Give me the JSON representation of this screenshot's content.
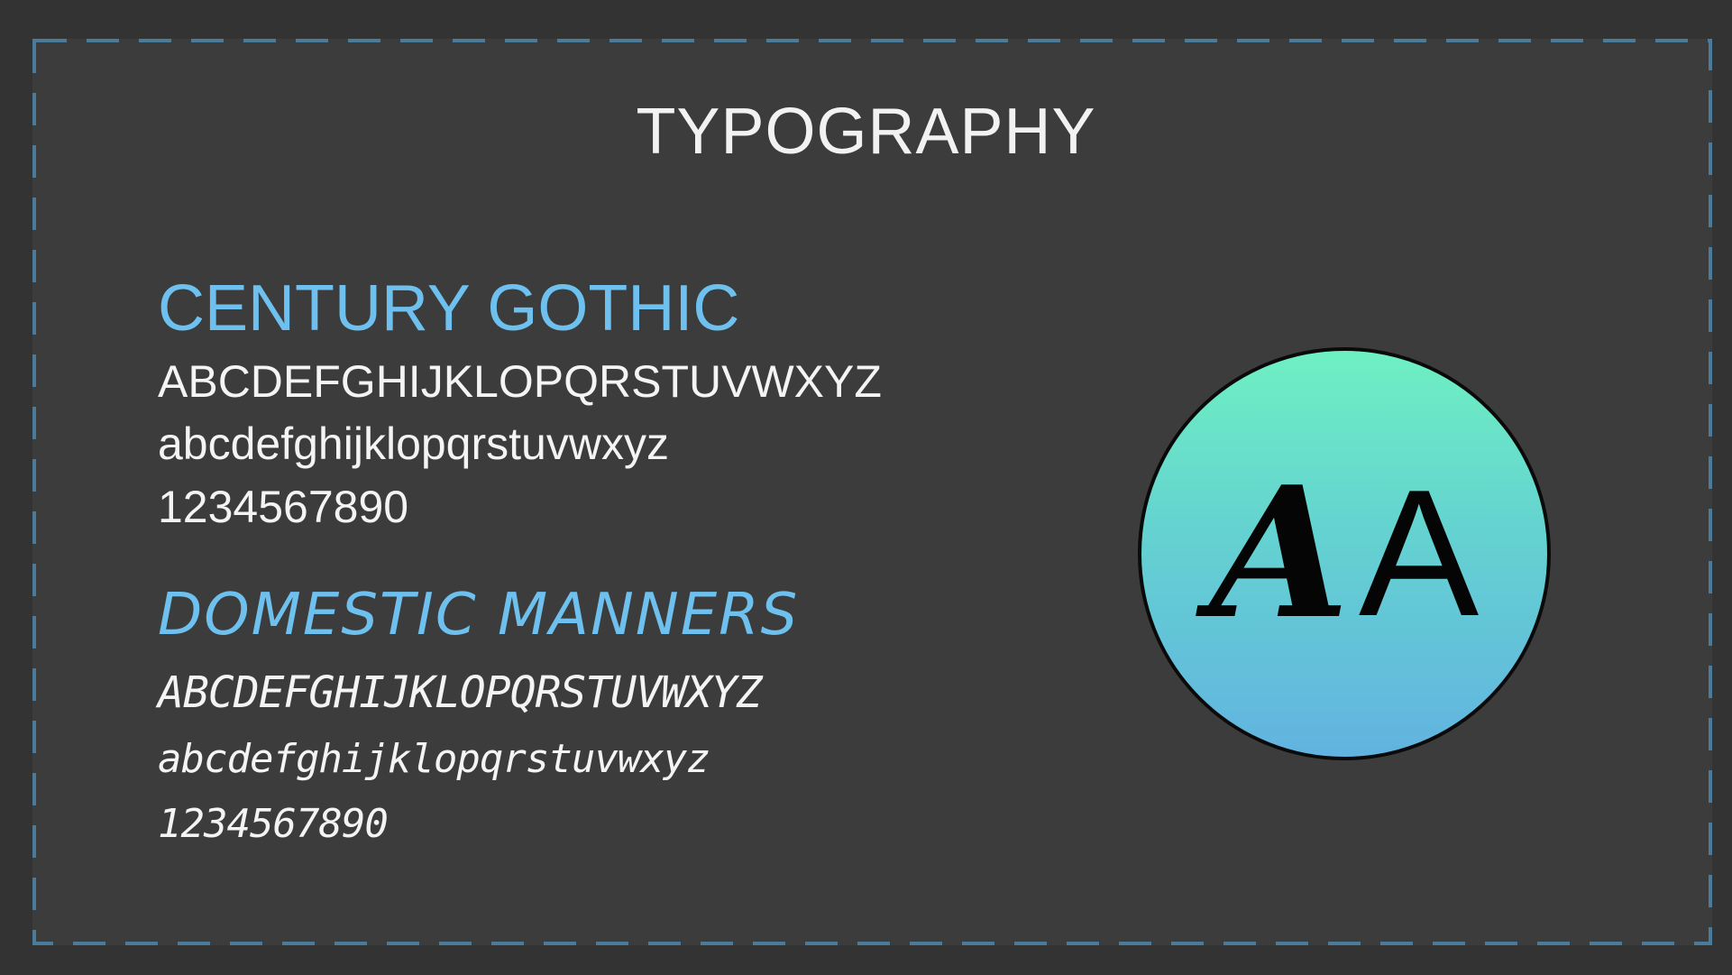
{
  "slide": {
    "title": "TYPOGRAPHY",
    "colors": {
      "background": "#333333",
      "panel": "#3c3c3c",
      "dashed_border": "#4a7b99",
      "accent": "#6ec1ee",
      "text": "#f4f4f4",
      "circle_top": "#6ef0c2",
      "circle_bottom": "#62b3e0"
    }
  },
  "fonts": [
    {
      "name": "CENTURY GOTHIC",
      "uppercase": "ABCDEFGHIJKLOPQRSTUVWXYZ",
      "lowercase": "abcdefghijklopqrstuvwxyz",
      "digits": "1234567890"
    },
    {
      "name": "DOMESTIC MANNERS",
      "uppercase": "ABCDEFGHIJKLOPQRSTUVWXYZ",
      "lowercase": "abcdefghijklopqrstuvwxyz",
      "digits": "1234567890"
    }
  ],
  "sample": {
    "script_letter": "A",
    "sans_letter": "A"
  }
}
